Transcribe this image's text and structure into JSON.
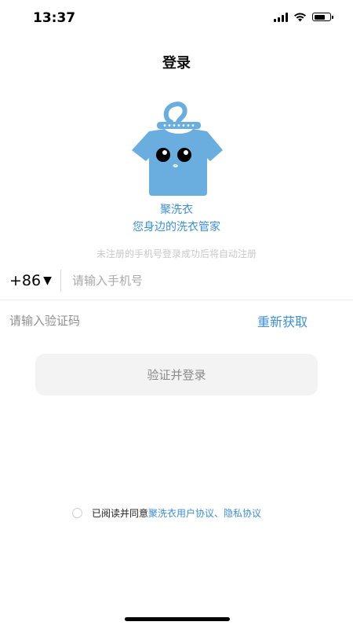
{
  "status_bar": {
    "time": "13:37"
  },
  "header": {
    "title": "登录"
  },
  "brand": {
    "name": "聚洗衣",
    "slogan": "您身边的洗衣管家"
  },
  "login": {
    "register_hint": "未注册的手机号登录成功后将自动注册",
    "country_code": "+86",
    "phone_placeholder": "请输入手机号",
    "code_placeholder": "请输入验证码",
    "resend_label": "重新获取",
    "submit_label": "验证并登录"
  },
  "agreement": {
    "text": "已阅读并同意",
    "user_agreement": "聚洗衣用户协议",
    "separator": "、",
    "privacy_policy": "隐私协议",
    "checked": false
  },
  "colors": {
    "accent": "#3d8fd6",
    "mascot": "#6aaee0",
    "button_bg": "#f3f3f3"
  },
  "icons": [
    "signal-icon",
    "wifi-icon",
    "battery-icon",
    "dropdown-caret-icon",
    "mascot-logo"
  ]
}
